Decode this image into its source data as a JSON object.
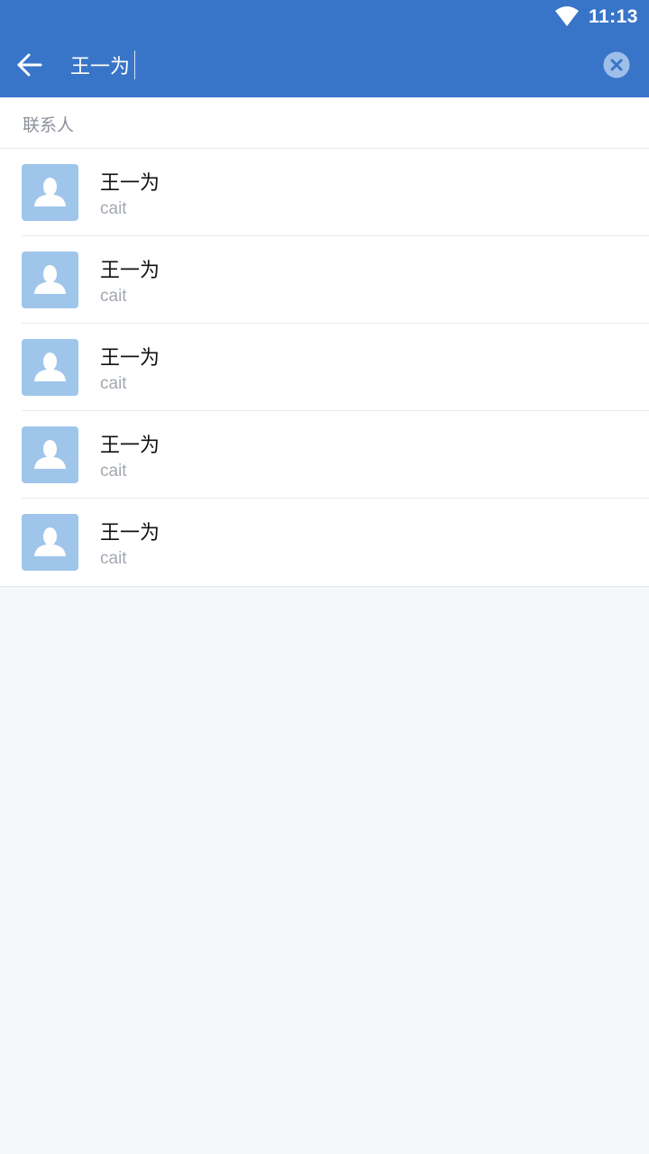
{
  "status_bar": {
    "time": "11:13",
    "wifi_icon": "wifi-icon"
  },
  "header": {
    "back_icon": "arrow-left-icon",
    "search_value": "王一为",
    "clear_icon": "close-circle-icon",
    "colors": {
      "primary": "#3875c8"
    }
  },
  "section": {
    "title": "联系人"
  },
  "contacts": [
    {
      "name": "王一为",
      "sub": "cait",
      "avatar_icon": "person-icon"
    },
    {
      "name": "王一为",
      "sub": "cait",
      "avatar_icon": "person-icon"
    },
    {
      "name": "王一为",
      "sub": "cait",
      "avatar_icon": "person-icon"
    },
    {
      "name": "王一为",
      "sub": "cait",
      "avatar_icon": "person-icon"
    },
    {
      "name": "王一为",
      "sub": "cait",
      "avatar_icon": "person-icon"
    }
  ],
  "colors": {
    "avatar_bg": "#9fc5eb",
    "page_bg": "#f4f6fa"
  }
}
